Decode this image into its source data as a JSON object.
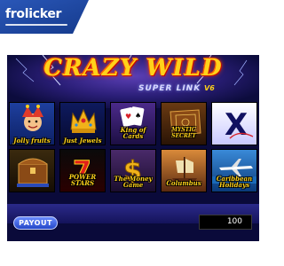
{
  "brand": {
    "name": "frolicker"
  },
  "game": {
    "title": "CRAZY WILD",
    "subtitle": "SUPER LINK",
    "version": "V6"
  },
  "tiles": [
    {
      "label": "Jolly fruits",
      "icon": "jester-icon"
    },
    {
      "label": "Just Jewels",
      "icon": "crown-icon"
    },
    {
      "label": "King of Cards",
      "icon": "cards-icon"
    },
    {
      "label": "MYSTIC SECRET",
      "icon": "book-icon"
    },
    {
      "label": "X",
      "icon": "x-icon"
    },
    {
      "label": "",
      "icon": "treasure-chest-icon"
    },
    {
      "label": "POWER STARS",
      "icon": "lucky-seven-icon"
    },
    {
      "label": "The Money Game",
      "icon": "dollar-icon"
    },
    {
      "label": "Columbus",
      "icon": "ship-icon"
    },
    {
      "label": "Caribbean Holidays",
      "icon": "airplane-icon"
    }
  ],
  "footer": {
    "payout_label": "PAYOUT",
    "credit_value": "100"
  },
  "colors": {
    "title": "#ffd21a",
    "screen_bg": "#0a0a3a",
    "button": "#2447c8"
  }
}
